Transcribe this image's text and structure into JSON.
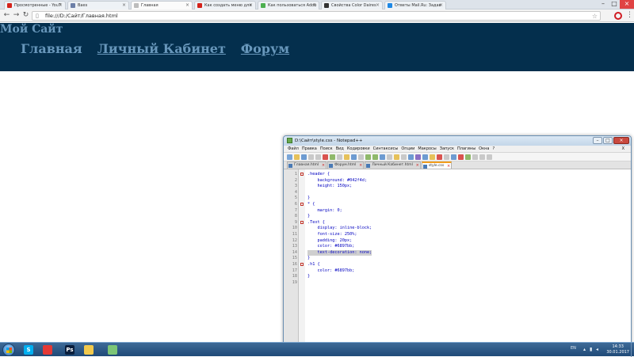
{
  "browser": {
    "tabs": [
      {
        "label": "Просмотренные - YouT",
        "fav_color": "#d4221b",
        "active": false
      },
      {
        "label": "Baes",
        "fav_color": "#6c7fa8",
        "active": false
      },
      {
        "label": "Главная",
        "fav_color": "#bdbdbd",
        "active": true
      },
      {
        "label": "Как создать меню для",
        "fav_color": "#d4221b",
        "active": false
      },
      {
        "label": "Как пользоваться Adob",
        "fav_color": "#4caf50",
        "active": false
      },
      {
        "label": "Свойства Color Daires",
        "fav_color": "#333333",
        "active": false
      },
      {
        "label": "Ответы Mail.Ru: Задав",
        "fav_color": "#1e88e5",
        "active": false
      }
    ],
    "url": "file:///D:/Сайт/Главная.html",
    "star_icon": "star-icon",
    "opera_icon": "opera-icon",
    "menu_icon": "menu-dots-icon"
  },
  "site": {
    "title": "Мой Сайт",
    "nav": [
      "Главная",
      "Личный Кабинет",
      "Форум"
    ],
    "colors": {
      "header_bg": "#042f4d",
      "link": "#6897bb"
    }
  },
  "notepad": {
    "title": "D:\\Сайт\\style.css - Notepad++",
    "menu": [
      "Файл",
      "Правка",
      "Поиск",
      "Вид",
      "Кодировки",
      "Синтаксисы",
      "Опции",
      "Макросы",
      "Запуск",
      "Плагины",
      "Окна",
      "?"
    ],
    "menu_close": "X",
    "tabs": [
      {
        "label": "Главная.html",
        "active": false
      },
      {
        "label": "Форум.html",
        "active": false
      },
      {
        "label": "Личный Кабинет.html",
        "active": false
      },
      {
        "label": "style.css",
        "active": true
      }
    ],
    "lines": [
      {
        "n": "1",
        "text": ".header {",
        "fold": true
      },
      {
        "n": "2",
        "text": "    background: #042f4d;",
        "fold": false
      },
      {
        "n": "3",
        "text": "    height: 150px;",
        "fold": false
      },
      {
        "n": "4",
        "text": "",
        "fold": false
      },
      {
        "n": "5",
        "text": "}",
        "fold": false
      },
      {
        "n": "6",
        "text": "* {",
        "fold": true
      },
      {
        "n": "7",
        "text": "    margin: 0;",
        "fold": false
      },
      {
        "n": "8",
        "text": "}",
        "fold": false
      },
      {
        "n": "9",
        "text": ".Text {",
        "fold": true
      },
      {
        "n": "10",
        "text": "    display: inline-block;",
        "fold": false
      },
      {
        "n": "11",
        "text": "    font-size: 250%;",
        "fold": false
      },
      {
        "n": "12",
        "text": "    padding: 20px;",
        "fold": false
      },
      {
        "n": "13",
        "text": "    color: #6897bb;",
        "fold": false
      },
      {
        "n": "14",
        "text": "    text-decoration: none;",
        "fold": false,
        "selected": true
      },
      {
        "n": "15",
        "text": "}",
        "fold": false
      },
      {
        "n": "16",
        "text": ".h1 {",
        "fold": true
      },
      {
        "n": "17",
        "text": "    color: #6897bb;",
        "fold": false
      },
      {
        "n": "18",
        "text": "}",
        "fold": false
      },
      {
        "n": "19",
        "text": "",
        "fold": false
      }
    ]
  },
  "taskbar": {
    "apps": [
      {
        "name": "skype",
        "label": "S",
        "color": "#00aff0"
      },
      {
        "name": "chrome",
        "label": "",
        "color": "#e53935"
      },
      {
        "name": "photoshop",
        "label": "Ps",
        "color": "#0a1f3d"
      },
      {
        "name": "explorer",
        "label": "",
        "color": "#f2c94c"
      },
      {
        "name": "notepadpp",
        "label": "",
        "color": "#7cc576"
      }
    ],
    "lang": "EN",
    "time": "14:33",
    "date": "30.01.2017"
  }
}
